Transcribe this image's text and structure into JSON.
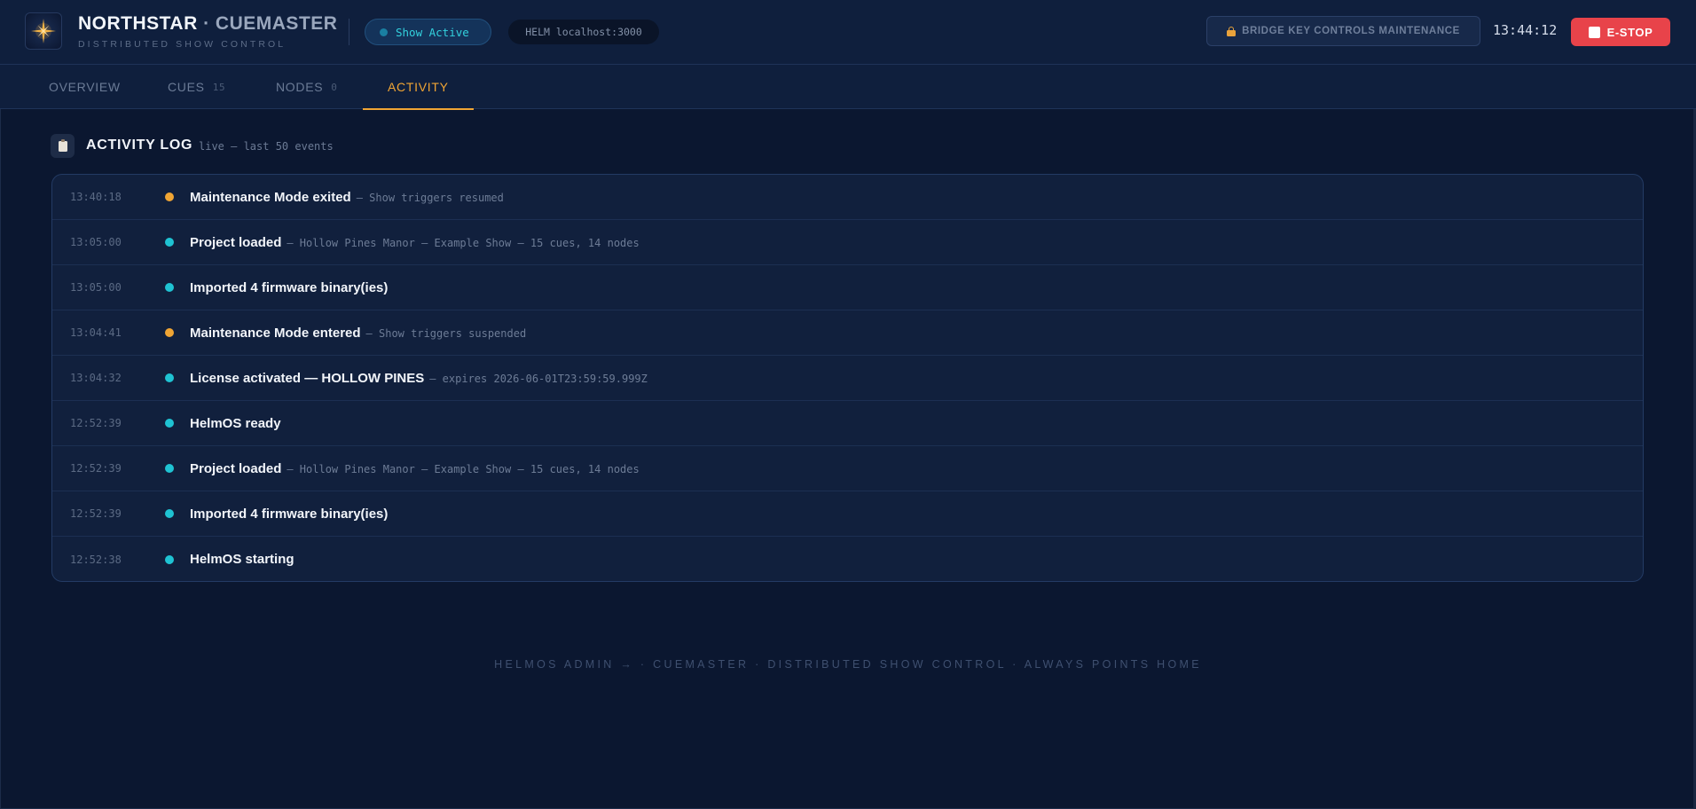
{
  "header": {
    "brand_name": "NORTHSTAR",
    "brand_suffix": "· CUEMASTER",
    "brand_subtitle": "DISTRIBUTED SHOW CONTROL",
    "show_status": "Show Active",
    "helm_address": "HELM localhost:3000",
    "bridge_key_label": "BRIDGE KEY CONTROLS MAINTENANCE",
    "clock": "13:44:12",
    "estop_label": "E-STOP"
  },
  "tabs": [
    {
      "label": "OVERVIEW",
      "count": ""
    },
    {
      "label": "CUES",
      "count": "15"
    },
    {
      "label": "NODES",
      "count": "0"
    },
    {
      "label": "ACTIVITY",
      "count": ""
    }
  ],
  "activity": {
    "title": "ACTIVITY LOG",
    "subtitle": "live — last 50 events",
    "colors": {
      "warning": "#f0a534",
      "info": "#1fc3d3"
    },
    "events": [
      {
        "time": "13:40:18",
        "level": "warning",
        "message": "Maintenance Mode exited",
        "detail": "— Show triggers resumed"
      },
      {
        "time": "13:05:00",
        "level": "info",
        "message": "Project loaded",
        "detail": "— Hollow Pines Manor — Example Show — 15 cues, 14 nodes"
      },
      {
        "time": "13:05:00",
        "level": "info",
        "message": "Imported 4 firmware binary(ies)",
        "detail": ""
      },
      {
        "time": "13:04:41",
        "level": "warning",
        "message": "Maintenance Mode entered",
        "detail": "— Show triggers suspended"
      },
      {
        "time": "13:04:32",
        "level": "info",
        "message": "License activated — HOLLOW PINES",
        "detail": "— expires 2026-06-01T23:59:59.999Z"
      },
      {
        "time": "12:52:39",
        "level": "info",
        "message": "HelmOS ready",
        "detail": ""
      },
      {
        "time": "12:52:39",
        "level": "info",
        "message": "Project loaded",
        "detail": "— Hollow Pines Manor — Example Show — 15 cues, 14 nodes"
      },
      {
        "time": "12:52:39",
        "level": "info",
        "message": "Imported 4 firmware binary(ies)",
        "detail": ""
      },
      {
        "time": "12:52:38",
        "level": "info",
        "message": "HelmOS starting",
        "detail": ""
      }
    ]
  },
  "footer": {
    "text": "HELMOS ADMIN → · CUEMASTER · DISTRIBUTED SHOW CONTROL · ALWAYS POINTS HOME"
  }
}
